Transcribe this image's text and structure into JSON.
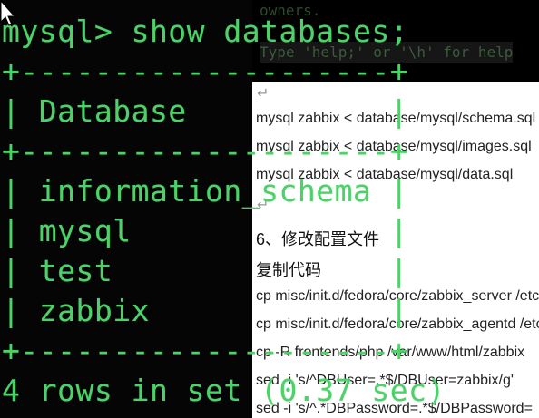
{
  "background_terminal": {
    "line_1": "owners.",
    "line_2": "Type 'help;' or '\\h' for help"
  },
  "document": {
    "lines": [
      "mysql zabbix < database/mysql/schema.sql",
      "mysql zabbix < database/mysql/images.sql",
      "mysql zabbix < database/mysql/data.sql",
      "6、修改配置文件",
      "复制代码",
      "cp misc/init.d/fedora/core/zabbix_server /etc/init.d/",
      "cp misc/init.d/fedora/core/zabbix_agentd /etc/init.d/",
      "cp -R frontends/php /var/www/html/zabbix",
      "sed -i 's/^DBUser=.*$/DBUser=zabbix/g'",
      "sed -i 's/^.*DBPassword=.*$/DBPassword="
    ]
  },
  "terminal": {
    "prompt_line": "mysql> show databases;",
    "border_line": "+--------------------+",
    "header_line": "| Database           |",
    "rows": [
      "| information_schema |",
      "| mysql              |",
      "| test               |",
      "| zabbix             |"
    ],
    "result_line": "4 rows in set (0.37 sec)"
  },
  "colors": {
    "terminal_green": "#4fd16a",
    "terminal_bg": "#050505",
    "document_bg": "#ffffff"
  }
}
